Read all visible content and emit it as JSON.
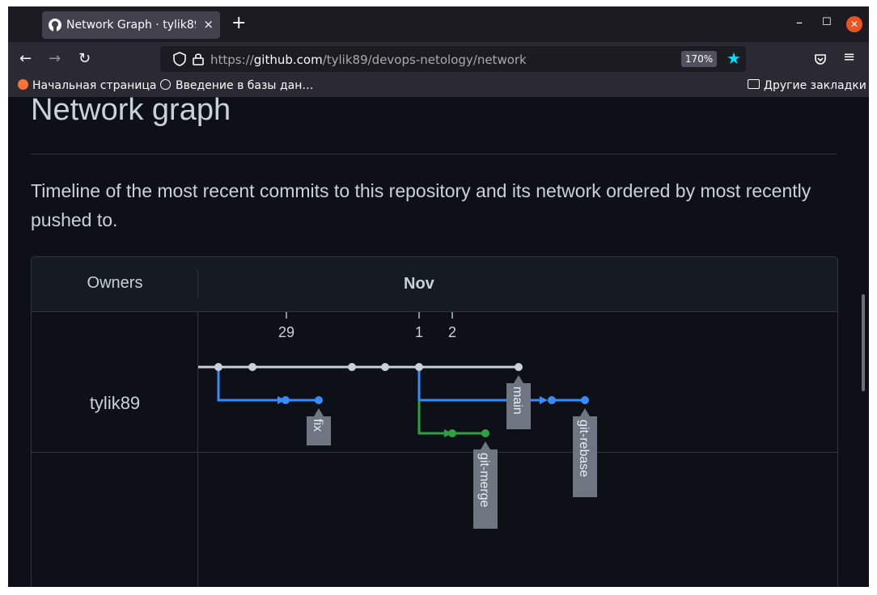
{
  "browser": {
    "tab_title": "Network Graph · tylik89/d",
    "tab_close": "×",
    "new_tab": "+",
    "url_scheme": "https://",
    "url_host": "github.com",
    "url_path": "/tylik89/devops-netology/network",
    "zoom": "170%",
    "bookmarks": [
      {
        "label": "Начальная страница",
        "icon": "firefox-icon"
      },
      {
        "label": "Введение в базы дан…",
        "icon": "bookmark-site-icon"
      }
    ],
    "other_bookmarks": "Другие закладки"
  },
  "page": {
    "title": "Network graph",
    "description": "Timeline of the most recent commits to this repository and its network ordered by most recently pushed to."
  },
  "graph": {
    "owners_header": "Owners",
    "month": "Nov",
    "days": [
      "29",
      "1",
      "2"
    ],
    "owner": "tylik89",
    "branch_labels": [
      "fix",
      "main",
      "git-merge",
      "git-rebase"
    ],
    "colors": {
      "main": "#c9d1d9",
      "blue": "#388bfd",
      "green": "#2ea043",
      "label_bg": "#6e7681"
    }
  }
}
